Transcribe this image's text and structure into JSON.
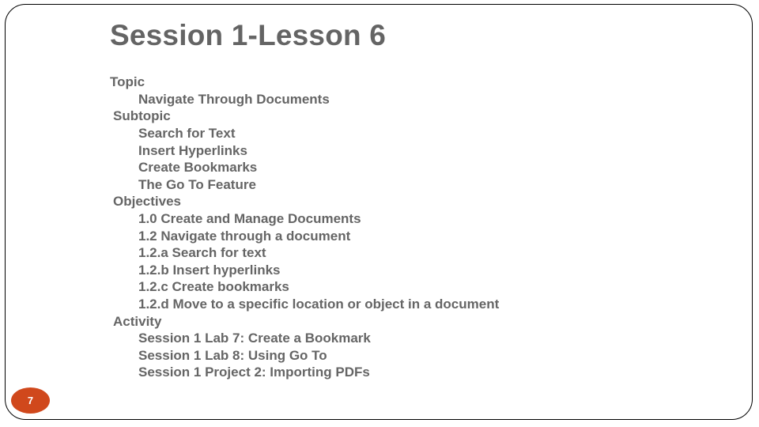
{
  "slide": {
    "title": "Session 1-Lesson 6",
    "page_number": "7",
    "accent_color": "#d0481c",
    "text_color": "#656565"
  },
  "outline": {
    "topic": {
      "heading": "Topic",
      "items": [
        "Navigate Through Documents"
      ]
    },
    "subtopic": {
      "heading": "Subtopic",
      "items": [
        "Search for Text",
        "Insert Hyperlinks",
        "Create Bookmarks",
        "The Go To Feature"
      ]
    },
    "objectives": {
      "heading": "Objectives",
      "items": [
        "1.0 Create and Manage Documents",
        "1.2 Navigate through a document",
        "1.2.a Search for text",
        "1.2.b Insert hyperlinks",
        "1.2.c Create bookmarks",
        "1.2.d Move to a specific location or object in a document"
      ]
    },
    "activity": {
      "heading": "Activity",
      "items": [
        "Session 1 Lab 7: Create a Bookmark",
        "Session 1 Lab 8: Using Go To",
        "Session 1 Project 2: Importing PDFs"
      ]
    }
  }
}
